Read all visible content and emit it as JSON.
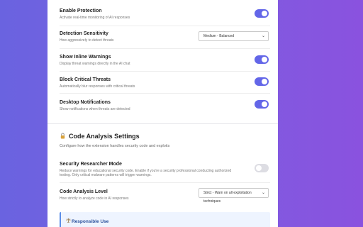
{
  "settings": [
    {
      "title": "Enable Protection",
      "desc": "Activate real-time monitoring of AI responses",
      "control": "toggle",
      "on": true
    },
    {
      "title": "Detection Sensitivity",
      "desc": "How aggressively to detect threats",
      "control": "select",
      "value": "Medium - Balanced"
    },
    {
      "title": "Show Inline Warnings",
      "desc": "Display threat warnings directly in the AI chat",
      "control": "toggle",
      "on": true
    },
    {
      "title": "Block Critical Threats",
      "desc": "Automatically blur responses with critical threats",
      "control": "toggle",
      "on": true
    },
    {
      "title": "Desktop Notifications",
      "desc": "Show notifications when threats are detected",
      "control": "toggle",
      "on": true
    }
  ],
  "code_section": {
    "icon": "lock-icon",
    "title": "Code Analysis Settings",
    "desc": "Configure how the extension handles security code and exploits",
    "items": [
      {
        "title": "Security Researcher Mode",
        "desc1": "Reduce warnings for educational security code. Enable if you're a security professional conducting authorized",
        "desc2": "testing. Only critical malware patterns will trigger warnings.",
        "control": "toggle",
        "on": false
      },
      {
        "title": "Code Analysis Level",
        "desc": "How strictly to analyze code in AI responses",
        "control": "select",
        "value": "Strict - Warn on all exploitation techniques"
      }
    ]
  },
  "notice": {
    "icon": "scale-icon",
    "title": "Responsible Use"
  },
  "colors": {
    "accent": "#6366e8",
    "background_start": "#6a63e0",
    "background_end": "#8a52df"
  }
}
